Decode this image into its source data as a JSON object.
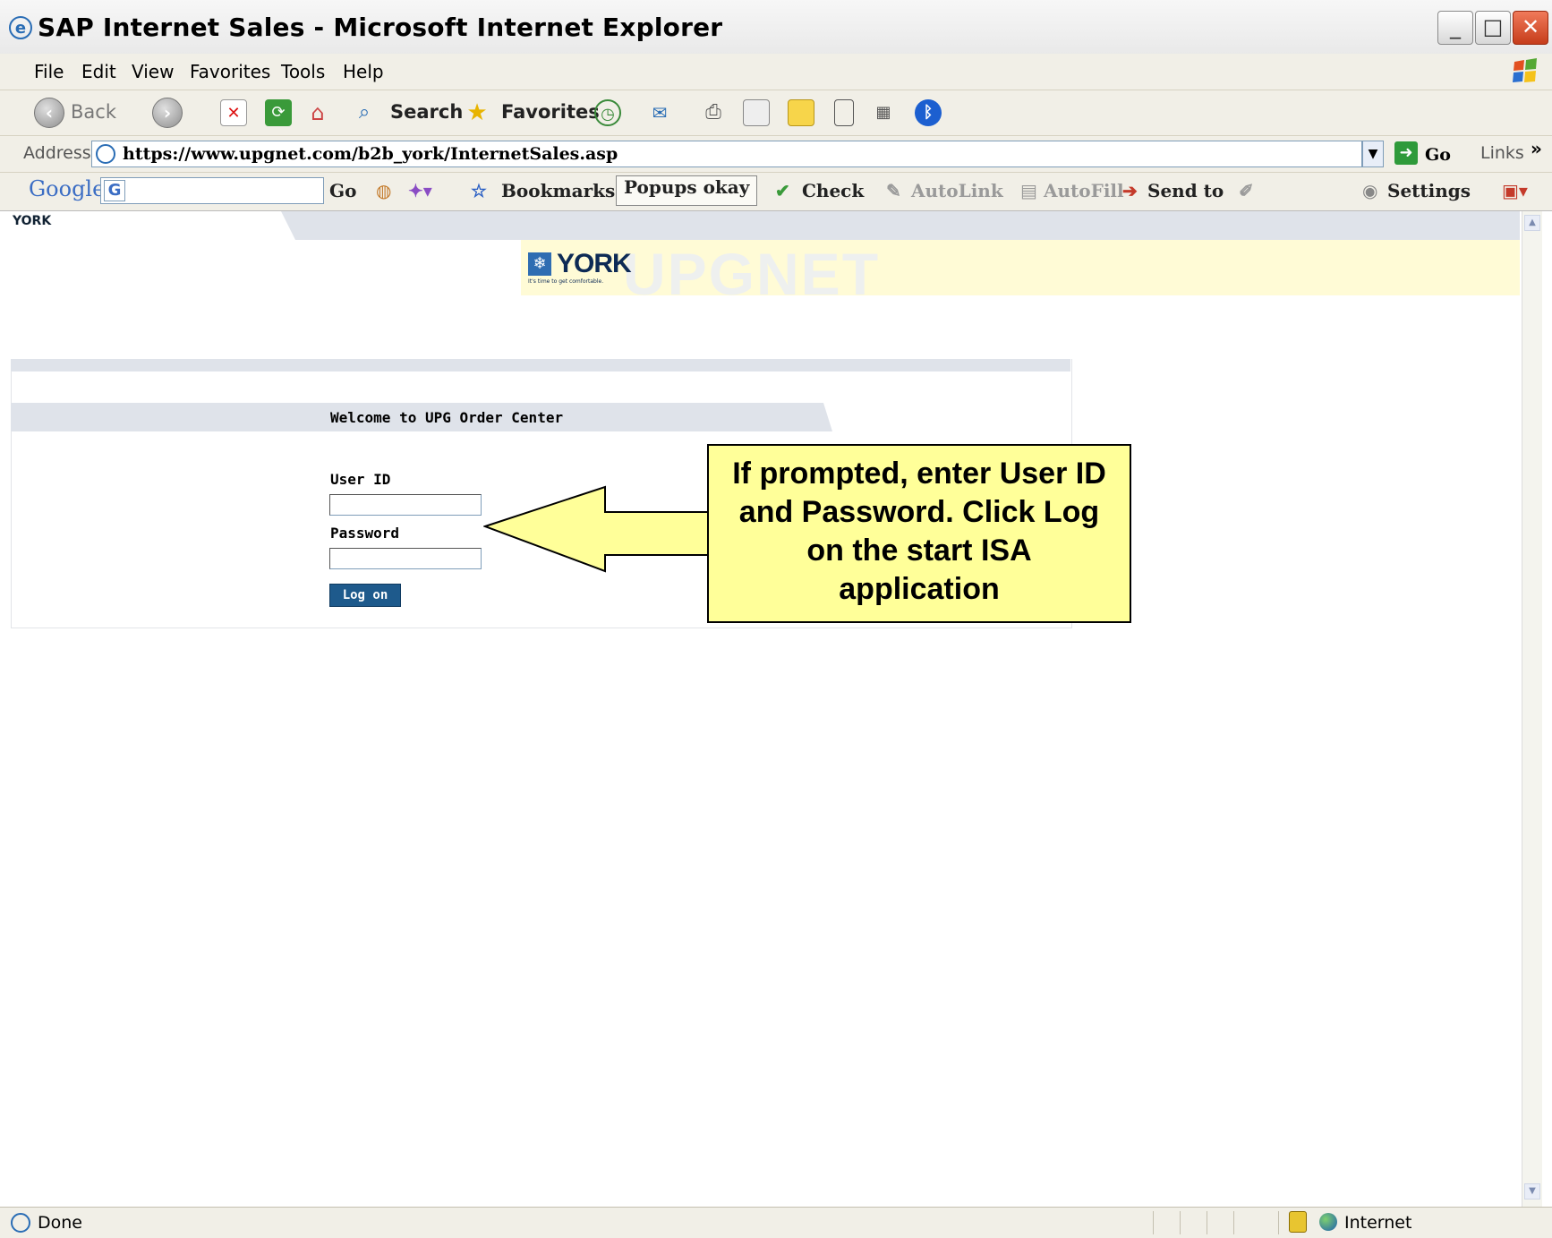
{
  "window": {
    "title": "SAP Internet Sales - Microsoft Internet Explorer",
    "min": "_",
    "max": "□",
    "close": "✕"
  },
  "menu": [
    "File",
    "Edit",
    "View",
    "Favorites",
    "Tools",
    "Help"
  ],
  "toolbar": {
    "back": "Back",
    "search": "Search",
    "favorites": "Favorites"
  },
  "address": {
    "label": "Address",
    "url": "https://www.upgnet.com/b2b_york/InternetSales.asp",
    "go": "Go",
    "links": "Links"
  },
  "google_toolbar": {
    "logo": "Google",
    "go": "Go",
    "bookmarks": "Bookmarks",
    "popups": "Popups okay",
    "check": "Check",
    "autolink": "AutoLink",
    "autofill": "AutoFill",
    "send_to": "Send to",
    "settings": "Settings"
  },
  "page": {
    "small_logo": "YORK",
    "logo": "YORK",
    "logo_tag": "It's time to get comfortable.",
    "banner_word": "UPGNET",
    "welcome": "Welcome to UPG Order Center",
    "user_id_label": "User ID",
    "user_id_value": "",
    "password_label": "Password",
    "password_value": "",
    "logon_button": "Log on"
  },
  "callout": {
    "text": "If prompted, enter User ID and Password. Click Log on the start ISA application"
  },
  "status": {
    "text": "Done",
    "zone": "Internet"
  },
  "colors": {
    "callout_fill": "#ffff99",
    "logon_button": "#1e5a8c",
    "banner_yellow": "#fffbd6",
    "panel_gray": "#dfe3ea"
  }
}
